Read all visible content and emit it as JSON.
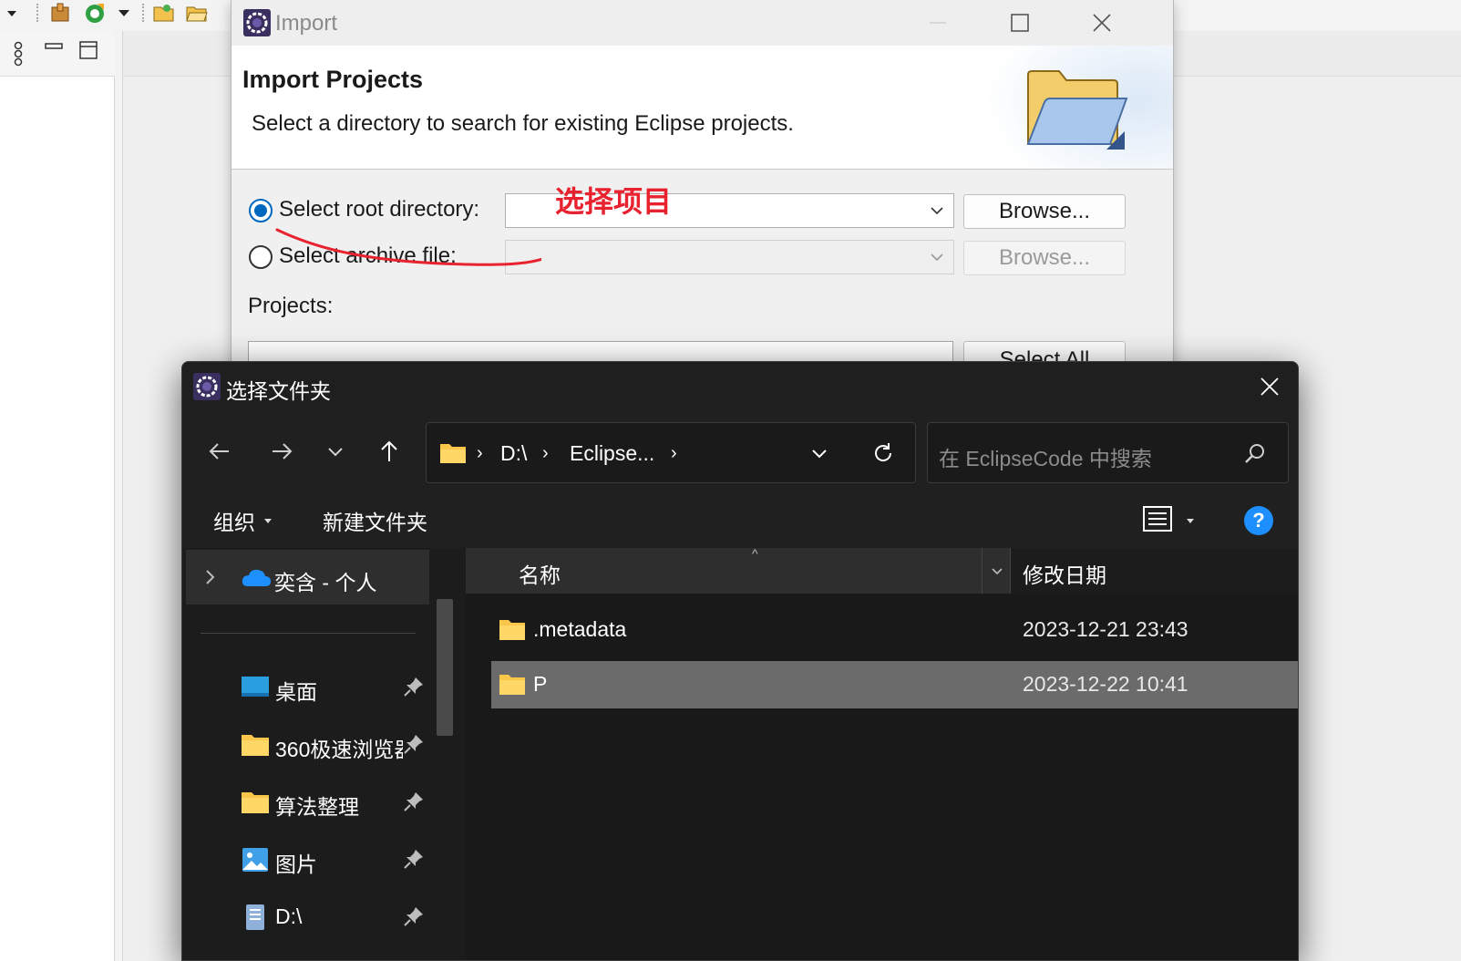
{
  "import_dialog": {
    "title": "Import",
    "heading": "Import Projects",
    "description": "Select a directory to search for existing Eclipse projects.",
    "radio_root_label": "Select root directory:",
    "radio_archive_label": "Select archive file:",
    "root_directory_value": "",
    "archive_file_value": "",
    "browse_root_label": "Browse...",
    "browse_archive_label": "Browse...",
    "projects_label": "Projects:",
    "select_all_label": "Select All"
  },
  "annotation": {
    "text": "选择项目",
    "color": "#e8232f"
  },
  "folder_dialog": {
    "title": "选择文件夹",
    "address": {
      "segments": [
        "D:\\",
        "Eclipse..."
      ]
    },
    "search_placeholder": "在 EclipseCode 中搜索",
    "cmdbar": {
      "organize_label": "组织",
      "new_folder_label": "新建文件夹",
      "help_label": "?"
    },
    "sidebar": {
      "onedrive_label": "奕含 - 个人",
      "items": [
        {
          "label": "桌面",
          "icon": "desktop-icon"
        },
        {
          "label": "360极速浏览器",
          "icon": "folder-icon"
        },
        {
          "label": "算法整理",
          "icon": "folder-icon"
        },
        {
          "label": "图片",
          "icon": "pictures-icon"
        },
        {
          "label": "D:\\",
          "icon": "drive-icon"
        }
      ]
    },
    "columns": {
      "name": "名称",
      "modified": "修改日期"
    },
    "files": [
      {
        "name": ".metadata",
        "modified": "2023-12-21 23:43",
        "selected": false
      },
      {
        "name": "P",
        "modified": "2023-12-22 10:41",
        "selected": true
      }
    ],
    "accent_color": "#1e8fff",
    "selection_color": "#6b6b6b"
  }
}
